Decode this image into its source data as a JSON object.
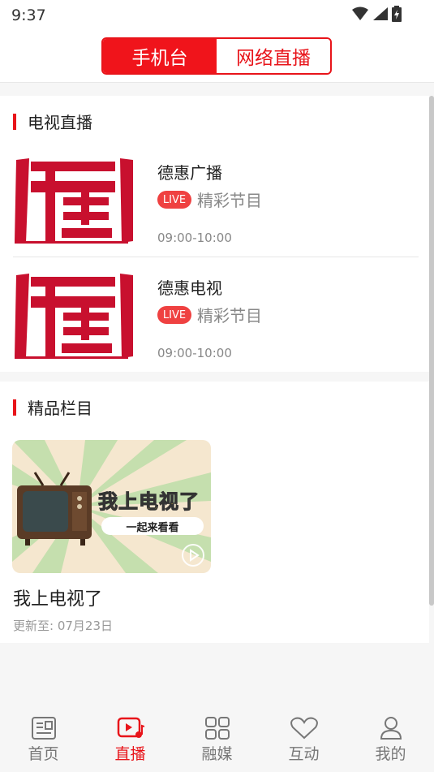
{
  "status_bar": {
    "time": "9:37",
    "icons": [
      "wifi-icon",
      "cellular-signal-icon",
      "battery-charging-icon"
    ]
  },
  "header": {
    "tabs": [
      {
        "label": "手机台",
        "active": true
      },
      {
        "label": "网络直播",
        "active": false
      }
    ]
  },
  "colors": {
    "accent": "#e8141a",
    "live_badge": "#ef4141",
    "muted_text": "#888888"
  },
  "tv_live": {
    "title": "电视直播",
    "channels": [
      {
        "name": "德惠广播",
        "badge": "LIVE",
        "program": "精彩节目",
        "time": "09:00-10:00",
        "logo": "de-seal-logo"
      },
      {
        "name": "德惠电视",
        "badge": "LIVE",
        "program": "精彩节目",
        "time": "09:00-10:00",
        "logo": "de-seal-logo"
      }
    ]
  },
  "premium": {
    "title": "精品栏目",
    "items": [
      {
        "title": "我上电视了",
        "update": "更新至: 07月23日",
        "thumb_title": "我上电视了",
        "thumb_subtitle": "一起来看看"
      }
    ]
  },
  "tabbar": {
    "items": [
      {
        "label": "首页",
        "icon": "news-icon",
        "active": false
      },
      {
        "label": "直播",
        "icon": "live-video-icon",
        "active": true
      },
      {
        "label": "融媒",
        "icon": "grid-icon",
        "active": false
      },
      {
        "label": "互动",
        "icon": "heart-icon",
        "active": false
      },
      {
        "label": "我的",
        "icon": "user-icon",
        "active": false
      }
    ]
  }
}
